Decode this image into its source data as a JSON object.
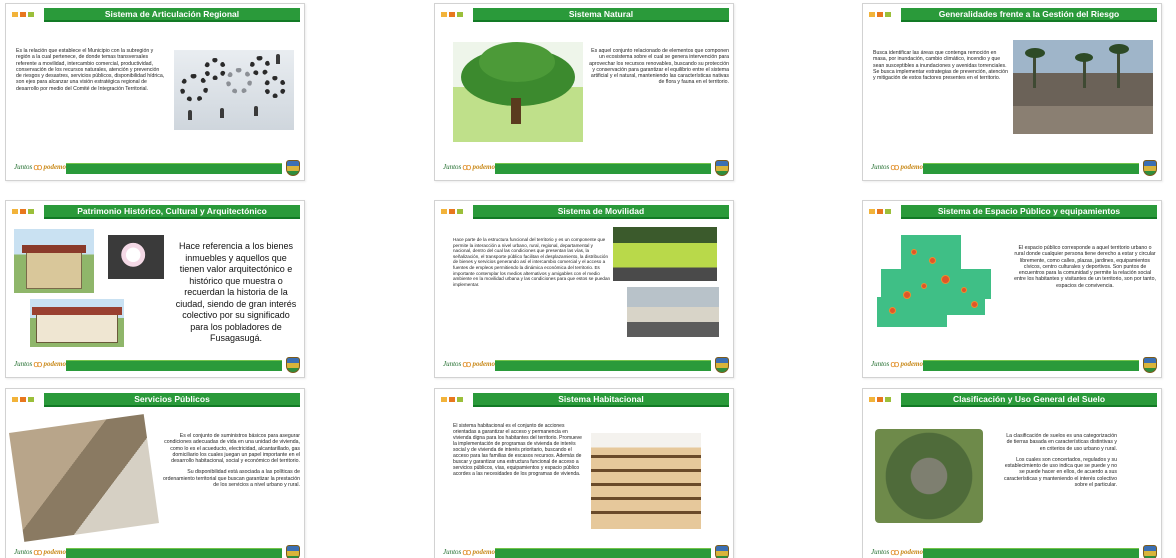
{
  "brand": {
    "logo_part1": "Juntos",
    "logo_part2": "podemos"
  },
  "colors": {
    "title_bar": "#2a9a3a",
    "title_border": "#127a25",
    "dot_1": "#f2b33a",
    "dot_2": "#e8771e",
    "dot_3": "#9bbf3a"
  },
  "slides": [
    {
      "title": "Sistema de Articulación Regional",
      "text": "Es la relación que establece el Municipio con la subregión y región a la cual pertenece, de donde temas transversales referente a movilidad, intercambio comercial, productividad, conservación de los recursos naturales, atención y prevención de riesgos y desastres, servicios públicos, disponibilidad hídrica, son ejes para alcanzar una visión estratégica regional de desarrollo por medio del Comité de Integración Territorial.",
      "image_icon": "gears-teamwork-image"
    },
    {
      "title": "Sistema Natural",
      "text": "Es aquel conjunto relacionado de elementos que componen un ecosistema sobre el cual se genera intervención para aprovechar los recursos renovables, buscando su protección y conservación para garantizar el equilibrio entre el sistema artificial y el natural, manteniendo las características nativas de flora y fauna en el territorio.",
      "image_icon": "tree-image"
    },
    {
      "title": "Generalidades frente a la Gestión del Riesgo",
      "text": "Busca identificar las áreas que contenga remoción en masa, por inundación, cambio climático, incendio y que sean susceptibles a inundaciones y avenidas torrenciales. Se busca implementar estrategias de prevención, atención y mitigación de estos factores presentes en el territorio.",
      "image_icon": "flooded-street-image"
    },
    {
      "title": "Patrimonio Histórico, Cultural y Arquitectónico",
      "text": "Hace referencia a los bienes inmuebles y aquellos que tienen valor arquitectónico e histórico que muestra o recuerdan la historia de la ciudad, siendo de gran interés colectivo por su significado para los pobladores de Fusagasugá.",
      "image_icon": "heritage-house-image"
    },
    {
      "title": "Sistema de Movilidad",
      "text": "Hace parte de la estructura funcional del territorio y es un componente que permite la interacción a nivel urbano, rural, regional, departamental y nacional, dentro del cual las condiciones que presentan las vías, la señalización, el transporte público facilitan el desplazamiento, la distribución de bienes y servicios generando así el intercambio comercial y el acceso a fuentes de empleos permitiendo la dinámica económica del territorio. Es importante contemplar los medios alternativos y amigables con el medio ambiente en la movilidad urbana y las condiciones para que estos se puedan implementar.",
      "image_icon": "traffic-officers-image"
    },
    {
      "title": "Sistema de Espacio Público y equipamientos",
      "text": "El espacio público corresponde a aquel territorio urbano o rural donde cualquier persona tiene derecho a estar y circular libremente, como calles, plazas, jardines, equipamientos cívicos, centro culturales y deportivos. Son puntos de encuentros para la comunidad y permite la relación social entre los habitantes y visitantes de un territorio, son por tanto, espacios de convivencia.",
      "image_icon": "urban-map-image"
    },
    {
      "title": "Servicios Públicos",
      "text_1": "Es el conjunto de suministros básicos para asegurar condiciones adecuadas de vida en una unidad de vivienda, como lo es el acueducto, electricidad, alcantarillado, gas domiciliario los cuales juegan un papel importante en el desarrollo habitacional, social y económico del territorio.",
      "text_2": "Su disponibilidad está asociada a las políticas de ordenamiento territorial que buscan garantizar la prestación de los servicios a nivel urbano y rural.",
      "image_icon": "public-works-image"
    },
    {
      "title": "Sistema Habitacional",
      "text": "El sistema habitacional es el conjunto de acciones orientadas a garantizar el acceso y permanencia en vivienda digna para los habitantes del territorio. Promueve la implementación de programas de vivienda de interés social y de vivienda de interés prioritario, buscando el acceso para las familias de escasos recursos. Además de buscar y garantizar una estructura funcional de acceso a servicios públicos, vías, equipamientos y espacio público acordes a las necesidades de los programas de vivienda.",
      "image_icon": "apartment-building-image"
    },
    {
      "title": "Clasificación y Uso General del Suelo",
      "text_1": "La clasificación de suelos es una categorización de tierras basada en características distintivas y en criterios de uso urbano y rural.",
      "text_2": "Los cuales son concertados, regulados y su establecimiento de uso indica que se puede y no se puede hacer en ellos, de acuerdo a sus características y manteniendo el interés colectivo sobre el particular.",
      "image_icon": "satellite-map-image"
    }
  ]
}
